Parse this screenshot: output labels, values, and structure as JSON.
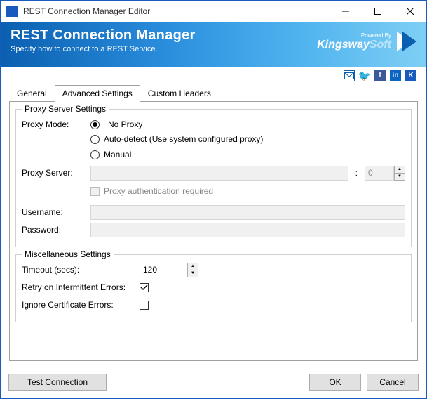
{
  "window": {
    "title": "REST Connection Manager Editor"
  },
  "banner": {
    "title": "REST Connection Manager",
    "subtitle": "Specify how to connect to a REST Service.",
    "powered_by": "Powered By",
    "brand_left": "Kingsway",
    "brand_right": "Soft"
  },
  "tabs": {
    "general": "General",
    "advanced": "Advanced Settings",
    "custom": "Custom Headers"
  },
  "proxy": {
    "legend": "Proxy Server Settings",
    "mode_label": "Proxy Mode:",
    "no_proxy": "No Proxy",
    "auto": "Auto-detect (Use system configured proxy)",
    "manual": "Manual",
    "server_label": "Proxy Server:",
    "server_value": "",
    "port_value": "0",
    "auth_label": "Proxy authentication required",
    "user_label": "Username:",
    "user_value": "",
    "pass_label": "Password:",
    "pass_value": ""
  },
  "misc": {
    "legend": "Miscellaneous Settings",
    "timeout_label": "Timeout (secs):",
    "timeout_value": "120",
    "retry_label": "Retry on Intermittent Errors:",
    "ignore_label": "Ignore Certificate Errors:"
  },
  "footer": {
    "test": "Test Connection",
    "ok": "OK",
    "cancel": "Cancel"
  }
}
